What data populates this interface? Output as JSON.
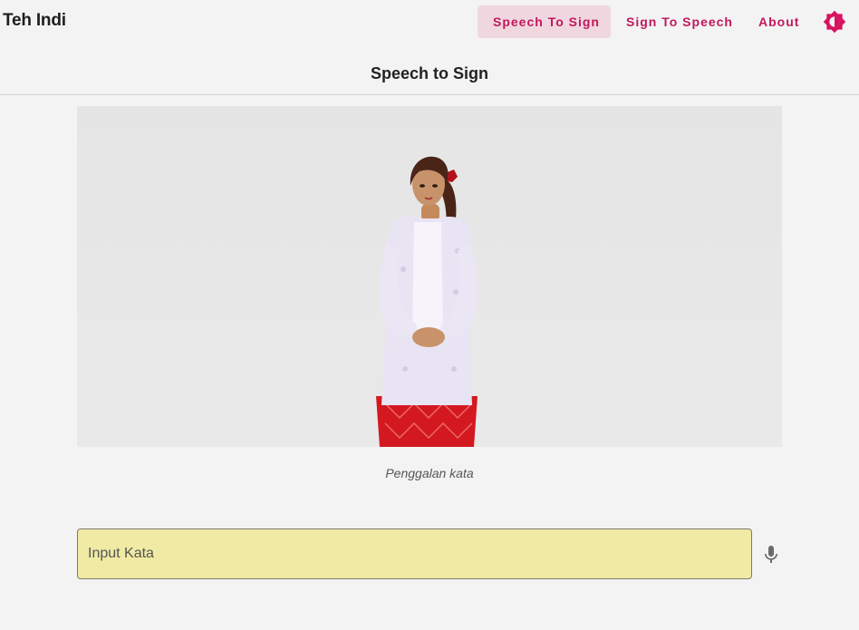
{
  "app": {
    "title": "Teh Indi"
  },
  "nav": {
    "items": [
      {
        "label": "Speech To Sign",
        "active": true
      },
      {
        "label": "Sign To Speech",
        "active": false
      },
      {
        "label": "About",
        "active": false
      }
    ],
    "theme_icon": "brightness-icon"
  },
  "page": {
    "title": "Speech to Sign"
  },
  "stage": {
    "caption": "Penggalan kata"
  },
  "input": {
    "placeholder": "Input Kata",
    "value": "",
    "mic_icon": "microphone-icon"
  },
  "colors": {
    "accent": "#c2185b",
    "active_bg": "#f0d7df",
    "input_bg": "#f0eaa5",
    "background": "#f3f3f3"
  }
}
